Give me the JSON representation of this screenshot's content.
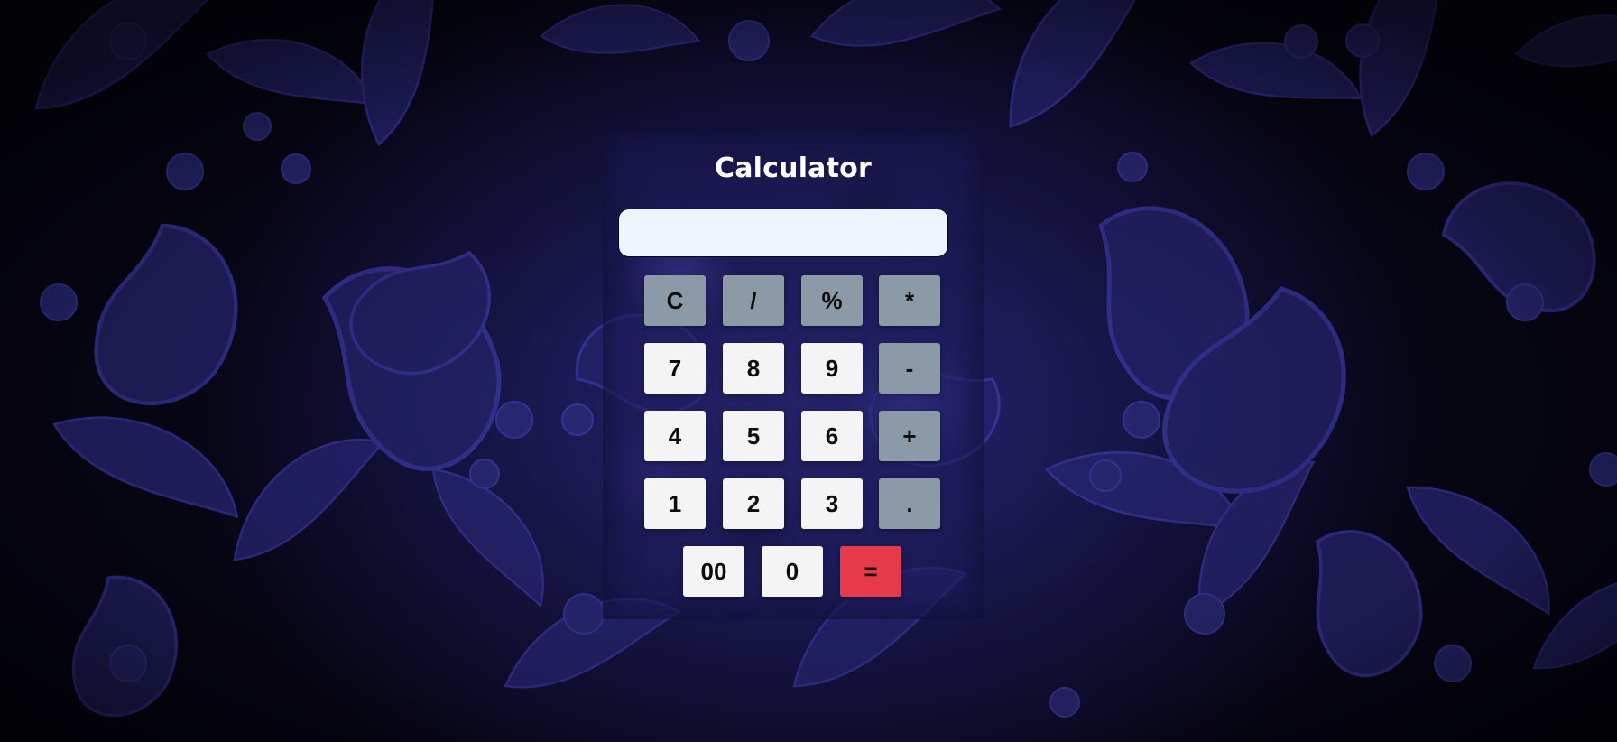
{
  "title": "Calculator",
  "display": {
    "value": "",
    "placeholder": ""
  },
  "colors": {
    "number_key": "#f4f4f4",
    "operator_key": "#8c9aa8",
    "equals_key": "#e6394a",
    "display_bg": "#eef5fd",
    "background": "#1e1c5a"
  },
  "keys": {
    "clear": "C",
    "divide": "/",
    "percent": "%",
    "multiply": "*",
    "seven": "7",
    "eight": "8",
    "nine": "9",
    "minus": "-",
    "four": "4",
    "five": "5",
    "six": "6",
    "plus": "+",
    "one": "1",
    "two": "2",
    "three": "3",
    "decimal": ".",
    "double_zero": "00",
    "zero": "0",
    "equals": "="
  }
}
